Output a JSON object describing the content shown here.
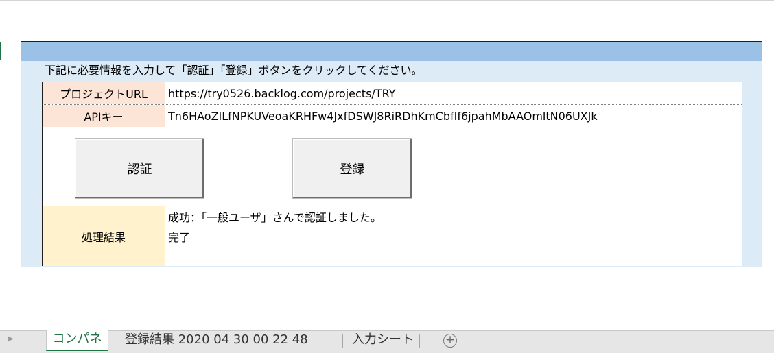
{
  "panel": {
    "instruction": "下記に必要情報を入力して「認証」「登録」ボタンをクリックしてください。"
  },
  "form": {
    "project_url_label": "プロジェクトURL",
    "project_url_value": "https://try0526.backlog.com/projects/TRY",
    "api_key_label": "APIキー",
    "api_key_value": "Tn6HAoZILfNPKUVeoaKRHFw4JxfDSWJ8RiRDhKmCbfIf6jpahMbAAOmltN06UXJk"
  },
  "buttons": {
    "auth_label": "認証",
    "register_label": "登録"
  },
  "result": {
    "label": "処理結果",
    "lines": [
      "成功：「一般ユーザ」さんで認証しました。",
      "完了"
    ]
  },
  "sheet_tabs": {
    "items": [
      "コンパネ",
      "登録結果 2020 04 30 00 22 48",
      "入力シート"
    ],
    "active_index": 0
  },
  "icons": {
    "tab_scroll": "triangle-right-icon",
    "add_sheet": "plus-circle-icon"
  },
  "colors": {
    "header_band": "#9bc2e6",
    "panel_bg": "#ddebf7",
    "input_label_bg": "#fce4d6",
    "result_label_bg": "#fff2cc",
    "active_tab": "#217346"
  }
}
